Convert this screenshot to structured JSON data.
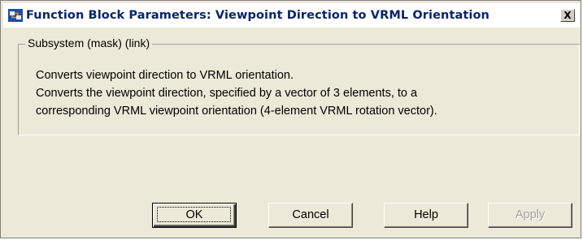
{
  "window": {
    "title": "Function Block Parameters: Viewpoint Direction to VRML Orientation",
    "close_label": "X"
  },
  "group": {
    "legend": "Subsystem (mask) (link)",
    "description_lines": [
      "Converts viewpoint direction to VRML orientation.",
      "Converts the viewpoint direction, specified by a vector of 3 elements, to a",
      "corresponding VRML viewpoint orientation (4-element VRML rotation vector)."
    ]
  },
  "buttons": {
    "ok": "OK",
    "cancel": "Cancel",
    "help": "Help",
    "apply": "Apply"
  },
  "colors": {
    "title_text": "#0a246a",
    "dialog_face": "#ece9d8"
  },
  "icons": {
    "app": "simulink-block-icon",
    "close": "close-icon"
  }
}
